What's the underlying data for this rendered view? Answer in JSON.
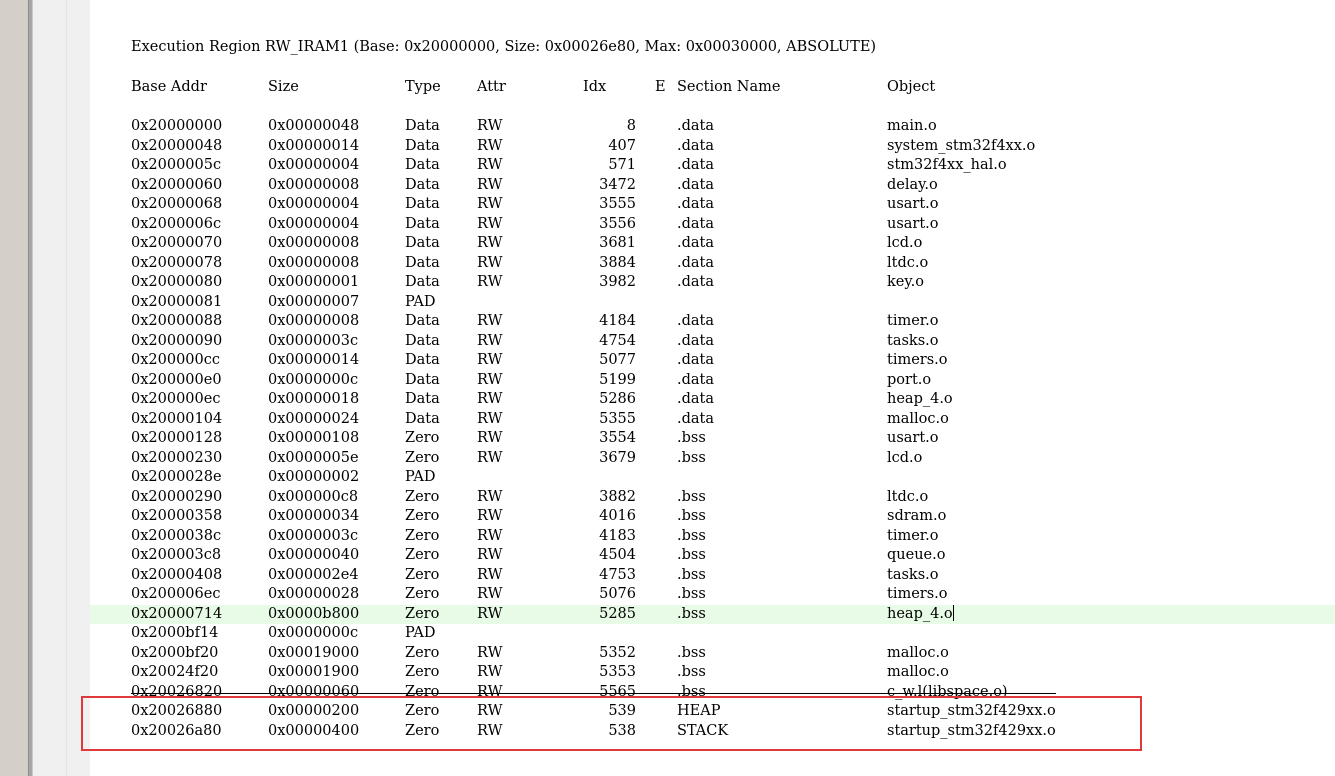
{
  "region_header": "Execution Region RW_IRAM1 (Base: 0x20000000, Size: 0x00026e80, Max: 0x00030000, ABSOLUTE)",
  "columns": {
    "base": "Base Addr",
    "size": "Size",
    "type": "Type",
    "attr": "Attr",
    "idx": "Idx",
    "e": "E",
    "section": "Section Name",
    "object": "Object"
  },
  "rows": [
    {
      "base": "0x20000000",
      "size": "0x00000048",
      "type": "Data",
      "attr": "RW",
      "idx": "8",
      "section": ".data",
      "object": "main.o"
    },
    {
      "base": "0x20000048",
      "size": "0x00000014",
      "type": "Data",
      "attr": "RW",
      "idx": "407",
      "section": ".data",
      "object": "system_stm32f4xx.o"
    },
    {
      "base": "0x2000005c",
      "size": "0x00000004",
      "type": "Data",
      "attr": "RW",
      "idx": "571",
      "section": ".data",
      "object": "stm32f4xx_hal.o"
    },
    {
      "base": "0x20000060",
      "size": "0x00000008",
      "type": "Data",
      "attr": "RW",
      "idx": "3472",
      "section": ".data",
      "object": "delay.o"
    },
    {
      "base": "0x20000068",
      "size": "0x00000004",
      "type": "Data",
      "attr": "RW",
      "idx": "3555",
      "section": ".data",
      "object": "usart.o"
    },
    {
      "base": "0x2000006c",
      "size": "0x00000004",
      "type": "Data",
      "attr": "RW",
      "idx": "3556",
      "section": ".data",
      "object": "usart.o"
    },
    {
      "base": "0x20000070",
      "size": "0x00000008",
      "type": "Data",
      "attr": "RW",
      "idx": "3681",
      "section": ".data",
      "object": "lcd.o"
    },
    {
      "base": "0x20000078",
      "size": "0x00000008",
      "type": "Data",
      "attr": "RW",
      "idx": "3884",
      "section": ".data",
      "object": "ltdc.o"
    },
    {
      "base": "0x20000080",
      "size": "0x00000001",
      "type": "Data",
      "attr": "RW",
      "idx": "3982",
      "section": ".data",
      "object": "key.o"
    },
    {
      "base": "0x20000081",
      "size": "0x00000007",
      "type": "PAD",
      "attr": "",
      "idx": "",
      "section": "",
      "object": ""
    },
    {
      "base": "0x20000088",
      "size": "0x00000008",
      "type": "Data",
      "attr": "RW",
      "idx": "4184",
      "section": ".data",
      "object": "timer.o"
    },
    {
      "base": "0x20000090",
      "size": "0x0000003c",
      "type": "Data",
      "attr": "RW",
      "idx": "4754",
      "section": ".data",
      "object": "tasks.o"
    },
    {
      "base": "0x200000cc",
      "size": "0x00000014",
      "type": "Data",
      "attr": "RW",
      "idx": "5077",
      "section": ".data",
      "object": "timers.o"
    },
    {
      "base": "0x200000e0",
      "size": "0x0000000c",
      "type": "Data",
      "attr": "RW",
      "idx": "5199",
      "section": ".data",
      "object": "port.o"
    },
    {
      "base": "0x200000ec",
      "size": "0x00000018",
      "type": "Data",
      "attr": "RW",
      "idx": "5286",
      "section": ".data",
      "object": "heap_4.o"
    },
    {
      "base": "0x20000104",
      "size": "0x00000024",
      "type": "Data",
      "attr": "RW",
      "idx": "5355",
      "section": ".data",
      "object": "malloc.o"
    },
    {
      "base": "0x20000128",
      "size": "0x00000108",
      "type": "Zero",
      "attr": "RW",
      "idx": "3554",
      "section": ".bss",
      "object": "usart.o"
    },
    {
      "base": "0x20000230",
      "size": "0x0000005e",
      "type": "Zero",
      "attr": "RW",
      "idx": "3679",
      "section": ".bss",
      "object": "lcd.o"
    },
    {
      "base": "0x2000028e",
      "size": "0x00000002",
      "type": "PAD",
      "attr": "",
      "idx": "",
      "section": "",
      "object": ""
    },
    {
      "base": "0x20000290",
      "size": "0x000000c8",
      "type": "Zero",
      "attr": "RW",
      "idx": "3882",
      "section": ".bss",
      "object": "ltdc.o"
    },
    {
      "base": "0x20000358",
      "size": "0x00000034",
      "type": "Zero",
      "attr": "RW",
      "idx": "4016",
      "section": ".bss",
      "object": "sdram.o"
    },
    {
      "base": "0x2000038c",
      "size": "0x0000003c",
      "type": "Zero",
      "attr": "RW",
      "idx": "4183",
      "section": ".bss",
      "object": "timer.o"
    },
    {
      "base": "0x200003c8",
      "size": "0x00000040",
      "type": "Zero",
      "attr": "RW",
      "idx": "4504",
      "section": ".bss",
      "object": "queue.o"
    },
    {
      "base": "0x20000408",
      "size": "0x000002e4",
      "type": "Zero",
      "attr": "RW",
      "idx": "4753",
      "section": ".bss",
      "object": "tasks.o"
    },
    {
      "base": "0x200006ec",
      "size": "0x00000028",
      "type": "Zero",
      "attr": "RW",
      "idx": "5076",
      "section": ".bss",
      "object": "timers.o"
    },
    {
      "base": "0x20000714",
      "size": "0x0000b800",
      "type": "Zero",
      "attr": "RW",
      "idx": "5285",
      "section": ".bss",
      "object": "heap_4.o"
    },
    {
      "base": "0x2000bf14",
      "size": "0x0000000c",
      "type": "PAD",
      "attr": "",
      "idx": "",
      "section": "",
      "object": ""
    },
    {
      "base": "0x2000bf20",
      "size": "0x00019000",
      "type": "Zero",
      "attr": "RW",
      "idx": "5352",
      "section": ".bss",
      "object": "malloc.o"
    },
    {
      "base": "0x20024f20",
      "size": "0x00001900",
      "type": "Zero",
      "attr": "RW",
      "idx": "5353",
      "section": ".bss",
      "object": "malloc.o"
    },
    {
      "base": "0x20026820",
      "size": "0x00000060",
      "type": "Zero",
      "attr": "RW",
      "idx": "5565",
      "section": ".bss",
      "object": "c_w.l(libspace.o)"
    },
    {
      "base": "0x20026880",
      "size": "0x00000200",
      "type": "Zero",
      "attr": "RW",
      "idx": "539",
      "section": "HEAP",
      "object": "startup_stm32f429xx.o"
    },
    {
      "base": "0x20026a80",
      "size": "0x00000400",
      "type": "Zero",
      "attr": "RW",
      "idx": "538",
      "section": "STACK",
      "object": "startup_stm32f429xx.o"
    }
  ],
  "highlighted_row": 25,
  "struck_row": 29,
  "annotation_color": "#e0393b",
  "highlight_color": "#e8fbe6"
}
